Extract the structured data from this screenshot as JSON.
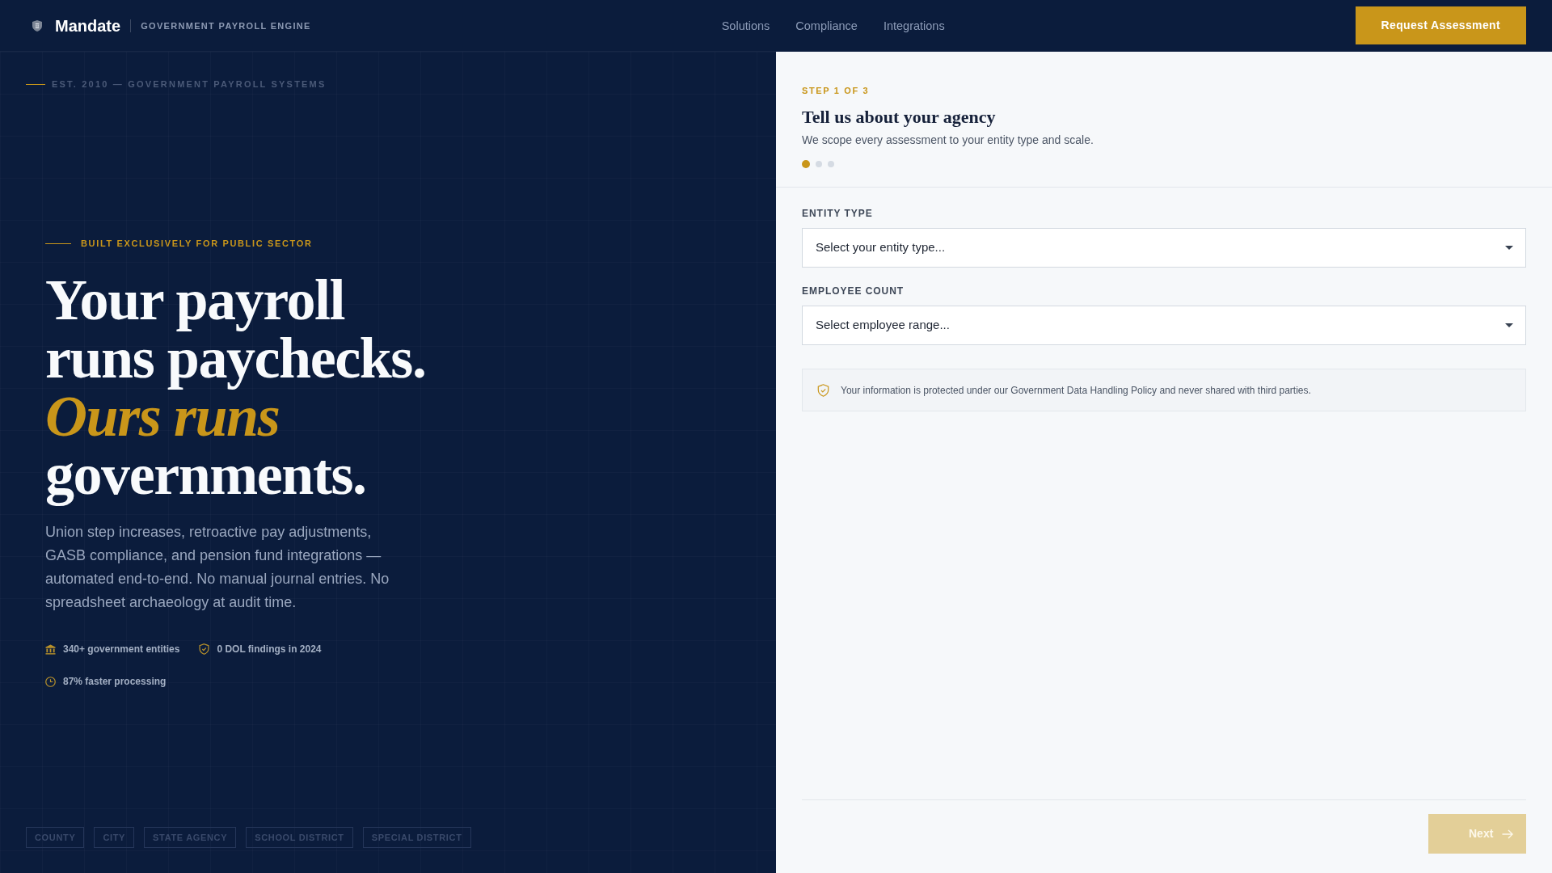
{
  "header": {
    "brand": "Mandate",
    "tagline": "GOVERNMENT PAYROLL ENGINE",
    "nav": [
      "Solutions",
      "Compliance",
      "Integrations"
    ],
    "cta": "Request Assessment"
  },
  "hero": {
    "established": "EST. 2010 — GOVERNMENT PAYROLL SYSTEMS",
    "eyebrow": "BUILT EXCLUSIVELY FOR PUBLIC SECTOR",
    "headline": [
      "Your payroll",
      "runs paychecks.",
      "*Ours runs*",
      "governments."
    ],
    "description": "Union step increases, retroactive pay adjustments, GASB compliance, and pension fund integrations — automated end-to-end. No manual journal entries. No spreadsheet archaeology at audit time.",
    "stats": [
      {
        "kind": "building",
        "text": "340+ government entities"
      },
      {
        "kind": "shield",
        "text": "0 DOL findings in 2024"
      },
      {
        "kind": "clock",
        "text": "87% faster processing"
      }
    ],
    "entity_tags": [
      "COUNTY",
      "CITY",
      "STATE AGENCY",
      "SCHOOL DISTRICT",
      "SPECIAL DISTRICT"
    ]
  },
  "form": {
    "step": "STEP 1 OF 3",
    "title": "Tell us about your agency",
    "subtitle": "We scope every assessment to your entity type and scale.",
    "step_dots": [
      {
        "selected": true
      },
      {
        "selected": false
      },
      {
        "selected": false
      }
    ],
    "fields": [
      {
        "label": "ENTITY TYPE",
        "placeholder": "Select your entity type..."
      },
      {
        "label": "EMPLOYEE COUNT",
        "placeholder": "Select employee range..."
      }
    ],
    "notice": "Your information is protected under our Government Data Handling Policy and never shared with third parties.",
    "next_button": {
      "label": "Next",
      "disabled": true
    }
  }
}
